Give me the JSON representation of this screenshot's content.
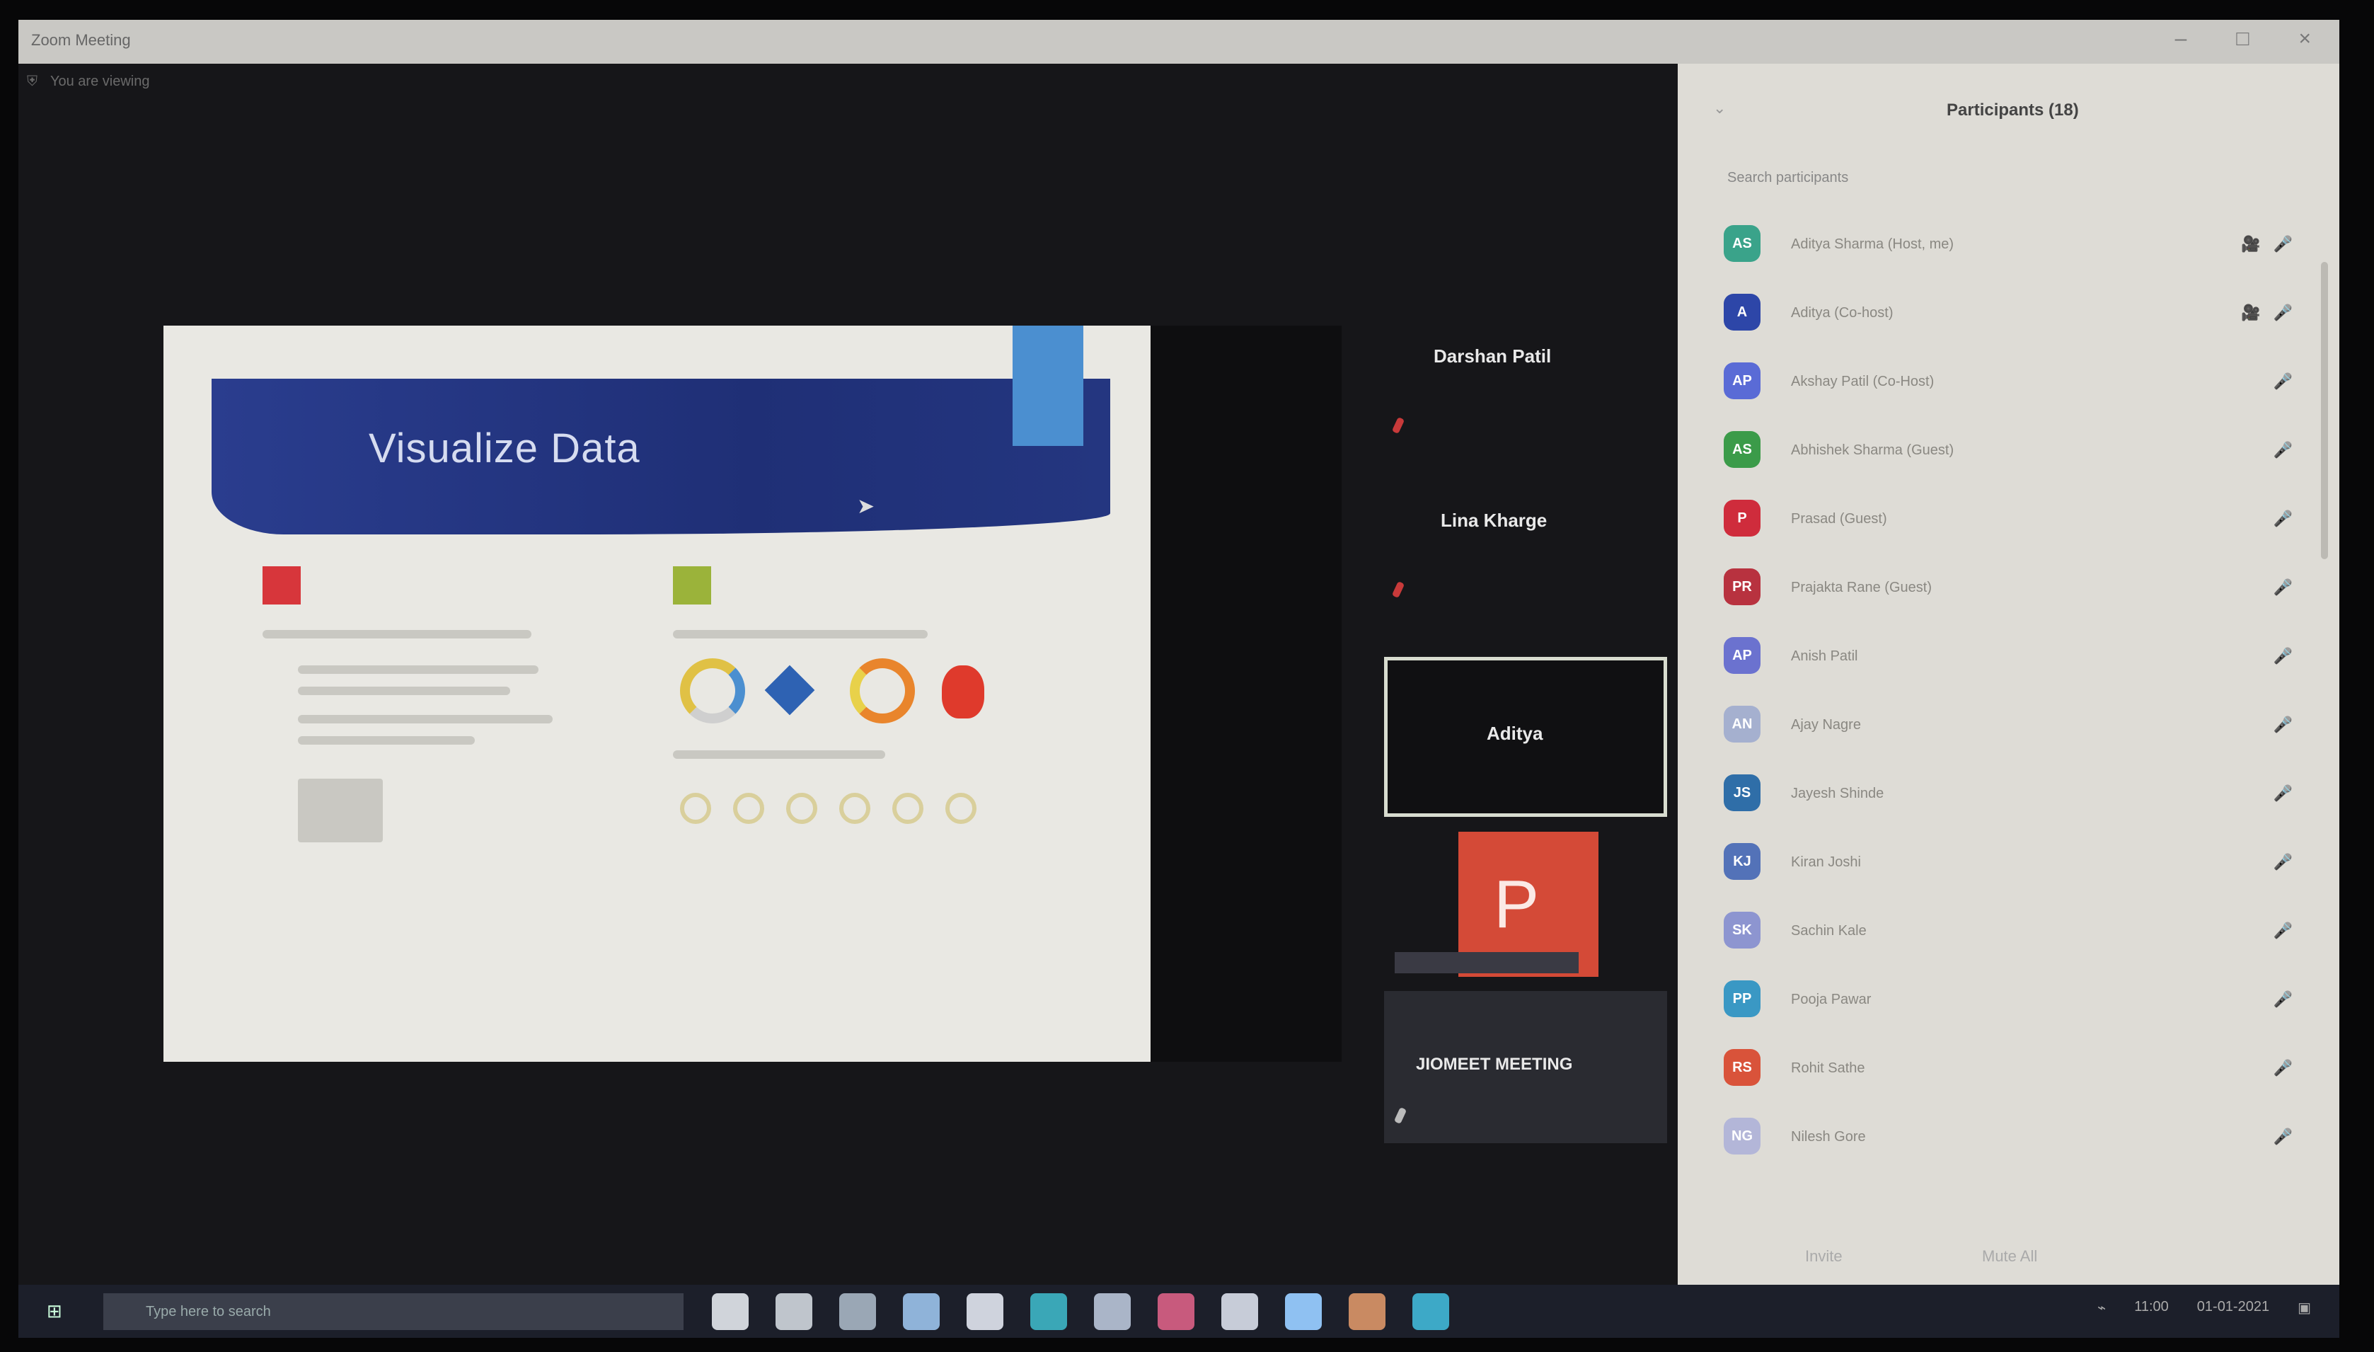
{
  "window": {
    "title": "Zoom Meeting"
  },
  "meeting": {
    "topbar_label": "You are viewing"
  },
  "slide": {
    "title": "Visualize Data"
  },
  "video_tiles": [
    {
      "name": "Darshan Patil"
    },
    {
      "name": "Lina Kharge"
    },
    {
      "name": "Aditya"
    },
    {
      "name": "P"
    },
    {
      "name": "JIOMEET MEETING"
    }
  ],
  "participants_panel": {
    "title": "Participants (18)",
    "search_placeholder": "Search participants",
    "footer": {
      "invite_label": "Invite",
      "mute_all_label": "Mute All"
    },
    "participants": [
      {
        "initials": "AS",
        "name": "Aditya Sharma (Host, me)",
        "status": "🎥 🎤",
        "color": "#3aa38a"
      },
      {
        "initials": "A",
        "name": "Aditya (Co-host)",
        "status": "🎥 🎤",
        "color": "#2d46a8"
      },
      {
        "initials": "AP",
        "name": "Akshay Patil (Co-Host)",
        "status": "🎤",
        "color": "#5a6bd6"
      },
      {
        "initials": "AS",
        "name": "Abhishek Sharma (Guest)",
        "status": "🎤",
        "color": "#3b9b49"
      },
      {
        "initials": "P",
        "name": "Prasad (Guest)",
        "status": "🎤",
        "color": "#cf2c3c"
      },
      {
        "initials": "PR",
        "name": "Prajakta Rane (Guest)",
        "status": "🎤",
        "color": "#b8323f"
      },
      {
        "initials": "AP",
        "name": "Anish Patil",
        "status": "🎤",
        "color": "#6b72cf"
      },
      {
        "initials": "AN",
        "name": "Ajay Nagre",
        "status": "🎤",
        "color": "#a5b0cf"
      },
      {
        "initials": "JS",
        "name": "Jayesh Shinde",
        "status": "🎤",
        "color": "#2f6ea8"
      },
      {
        "initials": "KJ",
        "name": "Kiran Joshi",
        "status": "🎤",
        "color": "#5372b8"
      },
      {
        "initials": "SK",
        "name": "Sachin Kale",
        "status": "🎤",
        "color": "#8d95d0"
      },
      {
        "initials": "PP",
        "name": "Pooja Pawar",
        "status": "🎤",
        "color": "#3a98c4"
      },
      {
        "initials": "RS",
        "name": "Rohit Sathe",
        "status": "🎤",
        "color": "#d9533a"
      },
      {
        "initials": "NG",
        "name": "Nilesh Gore",
        "status": "🎤",
        "color": "#b3b6d8"
      }
    ]
  },
  "taskbar": {
    "search_placeholder": "Type here to search",
    "icons": [
      {
        "name": "cortana-icon",
        "color": "#d0d4da"
      },
      {
        "name": "task-view-icon",
        "color": "#bfc5cc"
      },
      {
        "name": "file-explorer-icon",
        "color": "#9aa7b5"
      },
      {
        "name": "cloud-icon",
        "color": "#8fb3d9"
      },
      {
        "name": "store-icon",
        "color": "#cfd3dd"
      },
      {
        "name": "edge-icon",
        "color": "#3aa7b7"
      },
      {
        "name": "mail-icon",
        "color": "#aab5c8"
      },
      {
        "name": "photos-icon",
        "color": "#c85a7d"
      },
      {
        "name": "settings-icon",
        "color": "#c7ccd8"
      },
      {
        "name": "zoom-icon",
        "color": "#8fc1f2"
      },
      {
        "name": "app-icon",
        "color": "#c98a62"
      },
      {
        "name": "app2-icon",
        "color": "#3da9c7"
      }
    ],
    "tray": {
      "time": "11:00",
      "date": "01-01-2021"
    }
  }
}
